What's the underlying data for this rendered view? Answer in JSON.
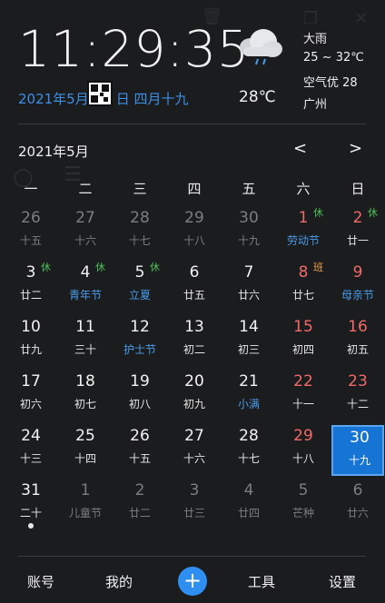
{
  "clock": {
    "time": "11:29:35"
  },
  "date_line": {
    "solar": "2021年5月",
    "after_qr": "日 四月十九"
  },
  "weather": {
    "current_temp": "28℃",
    "condition": "大雨",
    "temp_range": "25 ~ 32℃",
    "air_quality": "空气优 28",
    "city": "广州",
    "icon": "rain-cloud-icon"
  },
  "calendar": {
    "month_title": "2021年5月",
    "prev_label": "<",
    "next_label": ">",
    "weekdays": [
      "一",
      "二",
      "三",
      "四",
      "五",
      "六",
      "日"
    ],
    "rows": [
      [
        {
          "day": "26",
          "sub": "十五",
          "dim": true
        },
        {
          "day": "27",
          "sub": "十六",
          "dim": true
        },
        {
          "day": "28",
          "sub": "十七",
          "dim": true
        },
        {
          "day": "29",
          "sub": "十八",
          "dim": true
        },
        {
          "day": "30",
          "sub": "十九",
          "dim": true
        },
        {
          "day": "1",
          "sub": "劳动节",
          "red": true,
          "blue": true,
          "badge": "休",
          "badge_type": "xiu"
        },
        {
          "day": "2",
          "sub": "廿一",
          "red": true,
          "badge": "休",
          "badge_type": "xiu"
        }
      ],
      [
        {
          "day": "3",
          "sub": "廿二",
          "badge": "休",
          "badge_type": "xiu"
        },
        {
          "day": "4",
          "sub": "青年节",
          "blue": true,
          "badge": "休",
          "badge_type": "xiu"
        },
        {
          "day": "5",
          "sub": "立夏",
          "blue": true,
          "badge": "休",
          "badge_type": "xiu"
        },
        {
          "day": "6",
          "sub": "廿五"
        },
        {
          "day": "7",
          "sub": "廿六"
        },
        {
          "day": "8",
          "sub": "廿七",
          "red": true,
          "badge": "班",
          "badge_type": "ban"
        },
        {
          "day": "9",
          "sub": "母亲节",
          "red": true,
          "blue": true
        }
      ],
      [
        {
          "day": "10",
          "sub": "廿九"
        },
        {
          "day": "11",
          "sub": "三十"
        },
        {
          "day": "12",
          "sub": "护士节",
          "blue": true
        },
        {
          "day": "13",
          "sub": "初二"
        },
        {
          "day": "14",
          "sub": "初三"
        },
        {
          "day": "15",
          "sub": "初四",
          "red": true
        },
        {
          "day": "16",
          "sub": "初五",
          "red": true
        }
      ],
      [
        {
          "day": "17",
          "sub": "初六"
        },
        {
          "day": "18",
          "sub": "初七"
        },
        {
          "day": "19",
          "sub": "初八"
        },
        {
          "day": "20",
          "sub": "初九"
        },
        {
          "day": "21",
          "sub": "小满",
          "blue": true
        },
        {
          "day": "22",
          "sub": "十一",
          "red": true
        },
        {
          "day": "23",
          "sub": "十二",
          "red": true
        }
      ],
      [
        {
          "day": "24",
          "sub": "十三"
        },
        {
          "day": "25",
          "sub": "十四"
        },
        {
          "day": "26",
          "sub": "十五"
        },
        {
          "day": "27",
          "sub": "十六"
        },
        {
          "day": "28",
          "sub": "十七"
        },
        {
          "day": "29",
          "sub": "十八",
          "red": true
        },
        {
          "day": "30",
          "sub": "十九",
          "selected": true
        }
      ],
      [
        {
          "day": "31",
          "sub": "二十"
        },
        {
          "day": "1",
          "sub": "儿童节",
          "dim": true
        },
        {
          "day": "2",
          "sub": "廿二",
          "dim": true
        },
        {
          "day": "3",
          "sub": "廿三",
          "dim": true
        },
        {
          "day": "4",
          "sub": "廿四",
          "dim": true
        },
        {
          "day": "5",
          "sub": "芒种",
          "dim": true
        },
        {
          "day": "6",
          "sub": "廿六",
          "dim": true
        }
      ]
    ]
  },
  "bottom_bar": {
    "account": "账号",
    "mine": "我的",
    "add": "+",
    "tools": "工具",
    "settings": "设置"
  },
  "colors": {
    "accent": "#1674d4",
    "holiday_red": "#f06a6a",
    "festival_blue": "#4a9be8",
    "rest_green": "#4fbf5a"
  }
}
